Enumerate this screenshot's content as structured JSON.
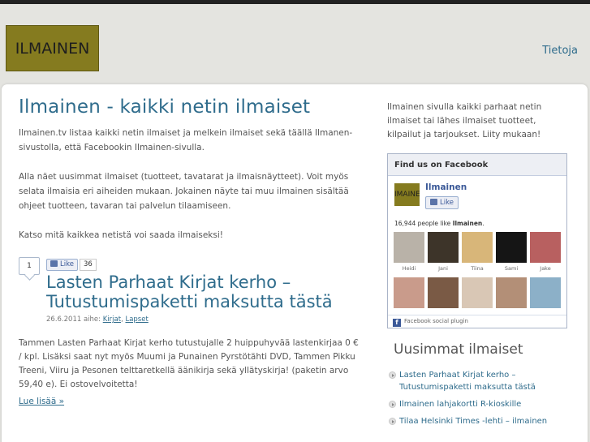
{
  "header": {
    "logo_text": "ILMAINEN",
    "nav_about": "Tietoja"
  },
  "main": {
    "page_title": "Ilmainen - kaikki netin ilmaiset",
    "intro": [
      "Ilmainen.tv listaa kaikki netin ilmaiset ja melkein ilmaiset sekä täällä Ilmanen-sivustolla, että Facebookin Ilmainen-sivulla.",
      "Alla näet uusimmat ilmaiset (tuotteet, tavatarat ja ilmaisnäytteet). Voit myös selata ilmaisia eri aiheiden mukaan. Jokainen näyte tai muu ilmainen sisältää ohjeet tuotteen, tavaran tai palvelun tilaamiseen.",
      "Katso mitä kaikkea netistä voi saada ilmaiseksi!"
    ],
    "post": {
      "comment_count": "1",
      "like_label": "Like",
      "like_count": "36",
      "title": "Lasten Parhaat Kirjat kerho – Tutustumispaketti maksutta tästä",
      "meta_prefix": "26.6.2011 aihe:",
      "category_1": "Kirjat",
      "category_2": "Lapset",
      "body": "Tammen Lasten Parhaat Kirjat kerho tutustujalle 2 huippuhyvää lastenkirjaa 0 € / kpl. Lisäksi saat nyt myös Muumi ja Punainen Pyrstötähti DVD, Tammen Pikku Treeni, Viiru ja Pesonen telttaretkellä äänikirja sekä yllätyskirja! (paketin arvo 59,40 e). Ei ostovelvoitetta!",
      "read_more": "Lue lisää »"
    }
  },
  "sidebar": {
    "intro": "Ilmainen sivulla kaikki parhaat netin ilmaiset tai lähes ilmaiset tuotteet, kilpailut ja tarjoukset. Liity mukaan!",
    "fb": {
      "header": "Find us on Facebook",
      "page_logo_text": "IMAINEN",
      "page_name": "Ilmainen",
      "like_label": "Like",
      "likers_count": "16,944 people like",
      "likers_page": "Ilmainen",
      "likers_end": ".",
      "faces": [
        {
          "name": "Heidi",
          "color": "#b9b2a8"
        },
        {
          "name": "Jani",
          "color": "#3d3429"
        },
        {
          "name": "Tiina",
          "color": "#d8b679"
        },
        {
          "name": "Sami",
          "color": "#151515"
        },
        {
          "name": "Jake",
          "color": "#b86060"
        },
        {
          "name": "",
          "color": "#c99b8b"
        },
        {
          "name": "",
          "color": "#7a5a45"
        },
        {
          "name": "",
          "color": "#d9c7b5"
        },
        {
          "name": "",
          "color": "#b38f77"
        },
        {
          "name": "",
          "color": "#8cb0c8"
        }
      ],
      "footer": "Facebook social plugin"
    },
    "latest_title": "Uusimmat ilmaiset",
    "latest": [
      "Lasten Parhaat Kirjat kerho – Tutustumispaketti maksutta tästä",
      "Ilmainen lahjakortti R-kioskille",
      "Tilaa Helsinki Times -lehti – ilmainen"
    ]
  },
  "colors": {
    "link": "#2f6c8c",
    "logo_bg": "#857b1f",
    "page_bg": "#e4e4e0"
  }
}
